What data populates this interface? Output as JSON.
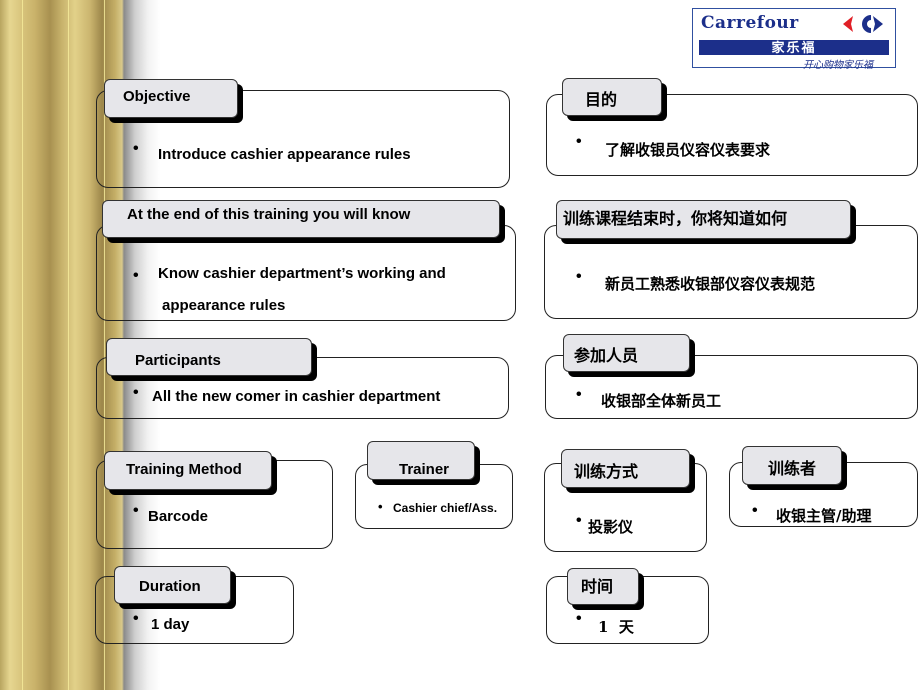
{
  "logo": {
    "brand": "Carrefour",
    "chinese": "家乐福",
    "tagline": "开心购物家乐福",
    "colors": {
      "blue": "#1c2f8a",
      "red": "#e01f26"
    }
  },
  "left": {
    "objective": {
      "title": "Objective",
      "bullet": "Introduce cashier appearance rules"
    },
    "end_of_training": {
      "title": "At the end of this training you will know",
      "line1": "Know cashier department’s working  and",
      "line2": "appearance rules"
    },
    "participants": {
      "title": "Participants",
      "bullet": "All the new comer  in cashier department"
    },
    "training_method": {
      "title": "Training Method",
      "bullet": "Barcode"
    },
    "trainer": {
      "title": "Trainer",
      "bullet": "Cashier chief/Ass."
    },
    "duration": {
      "title": "Duration",
      "bullet": "1 day"
    }
  },
  "right": {
    "objective": {
      "title": "目的",
      "bullet": "了解收银员仪容仪表要求"
    },
    "end_of_training": {
      "title": "训练课程结束时，你将知道如何",
      "bullet": "新员工熟悉收银部仪容仪表规范"
    },
    "participants": {
      "title": "参加人员",
      "bullet": "收银部全体新员工"
    },
    "training_method": {
      "title": "训练方式",
      "bullet": "投影仪"
    },
    "trainer": {
      "title": "训练者",
      "bullet": "收银主管/助理"
    },
    "duration": {
      "title": "时间",
      "bullet": "1  天"
    }
  },
  "bullet_symbol": "•"
}
